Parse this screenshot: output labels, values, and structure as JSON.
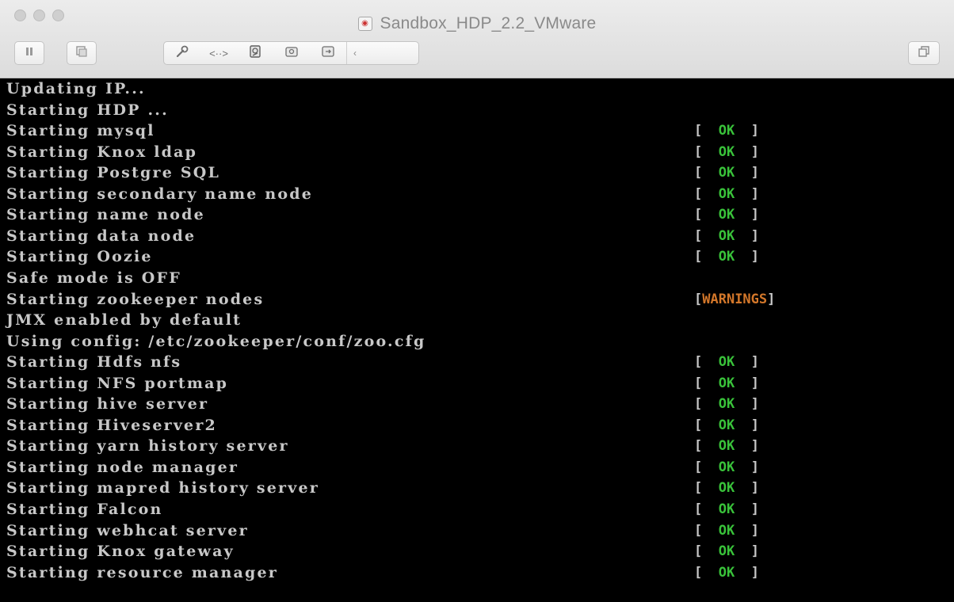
{
  "window": {
    "title": "Sandbox_HDP_2.2_VMware"
  },
  "toolbar": {
    "pause_icon": "pause-icon",
    "snapshot_icon": "snapshot-icon",
    "settings_icon": "wrench-icon",
    "network_icon": "network-arrows-icon",
    "disk_icon": "disk-icon",
    "cdrom_icon": "cdrom-icon",
    "usb_icon": "usb-icon",
    "more_icon": "chevron-left-icon",
    "fullscreen_icon": "window-restore-icon"
  },
  "console": {
    "lines": [
      {
        "text": "Updating IP...",
        "status": ""
      },
      {
        "text": "Starting HDP ...",
        "status": ""
      },
      {
        "text": "Starting mysql",
        "status": "OK"
      },
      {
        "text": "Starting Knox ldap",
        "status": "OK"
      },
      {
        "text": "Starting Postgre SQL",
        "status": "OK"
      },
      {
        "text": "Starting secondary name node",
        "status": "OK"
      },
      {
        "text": "Starting name node",
        "status": "OK"
      },
      {
        "text": "Starting data node",
        "status": "OK"
      },
      {
        "text": "Starting Oozie",
        "status": "OK"
      },
      {
        "text": "Safe mode is OFF",
        "status": ""
      },
      {
        "text": "Starting zookeeper nodes",
        "status": "WARNINGS"
      },
      {
        "text": "JMX enabled by default",
        "status": ""
      },
      {
        "text": "Using config: /etc/zookeeper/conf/zoo.cfg",
        "status": ""
      },
      {
        "text": "Starting Hdfs nfs",
        "status": "OK"
      },
      {
        "text": "Starting NFS portmap",
        "status": "OK"
      },
      {
        "text": "Starting hive server",
        "status": "OK"
      },
      {
        "text": "Starting Hiveserver2",
        "status": "OK"
      },
      {
        "text": "Starting yarn history server",
        "status": "OK"
      },
      {
        "text": "Starting node manager",
        "status": "OK"
      },
      {
        "text": "Starting mapred history server",
        "status": "OK"
      },
      {
        "text": "Starting Falcon",
        "status": "OK"
      },
      {
        "text": "Starting webhcat server",
        "status": "OK"
      },
      {
        "text": "Starting Knox gateway",
        "status": "OK"
      },
      {
        "text": "Starting resource manager",
        "status": "OK"
      }
    ]
  },
  "colors": {
    "ok": "#39c23a",
    "warning": "#d3772a",
    "console_text": "#c8c8c8",
    "console_bg": "#000000"
  }
}
